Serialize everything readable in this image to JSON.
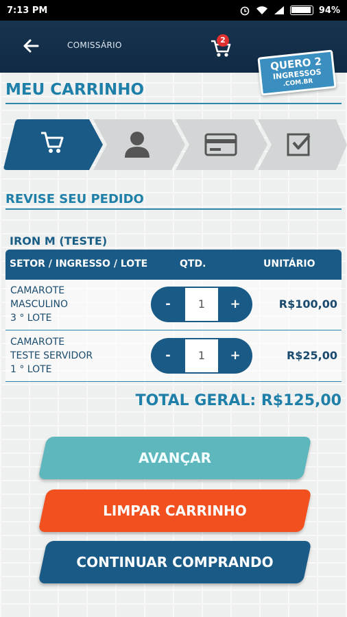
{
  "status_bar": {
    "time": "7:13 PM",
    "battery": "94%"
  },
  "header": {
    "merchant": "COMISSÁRIO",
    "cart_count": "2",
    "logo": {
      "line1": "QUERO 2",
      "line2": "INGRESSOS",
      "line3": ".COM.BR"
    }
  },
  "page": {
    "title": "MEU CARRINHO",
    "section_title": "REVISE SEU PEDIDO",
    "event_name": "IRON M (TESTE)"
  },
  "steps": [
    {
      "icon": "cart-icon",
      "active": true
    },
    {
      "icon": "user-icon",
      "active": false
    },
    {
      "icon": "credit-card-icon",
      "active": false
    },
    {
      "icon": "checkbox-icon",
      "active": false
    }
  ],
  "table": {
    "headers": {
      "item": "SETOR / INGRESSO / LOTE",
      "qty": "QTD.",
      "unit": "UNITÁRIO"
    },
    "rows": [
      {
        "line1": "CAMAROTE",
        "line2": "MASCULINO",
        "line3": "3 ° LOTE",
        "qty": "1",
        "price": "R$100,00",
        "minus": "-",
        "plus": "+"
      },
      {
        "line1": "CAMAROTE",
        "line2": "TESTE SERVIDOR",
        "line3": "1 ° LOTE",
        "qty": "1",
        "price": "R$25,00",
        "minus": "-",
        "plus": "+"
      }
    ]
  },
  "total": "TOTAL GERAL: R$125,00",
  "buttons": {
    "advance": "AVANÇAR",
    "clear": "LIMPAR CARRINHO",
    "continue": "CONTINUAR COMPRANDO"
  },
  "colors": {
    "header": "#17344f",
    "accent": "#1e7fa8",
    "advance": "#5db7bd",
    "clear": "#f2501f",
    "continue": "#1a5a86"
  }
}
